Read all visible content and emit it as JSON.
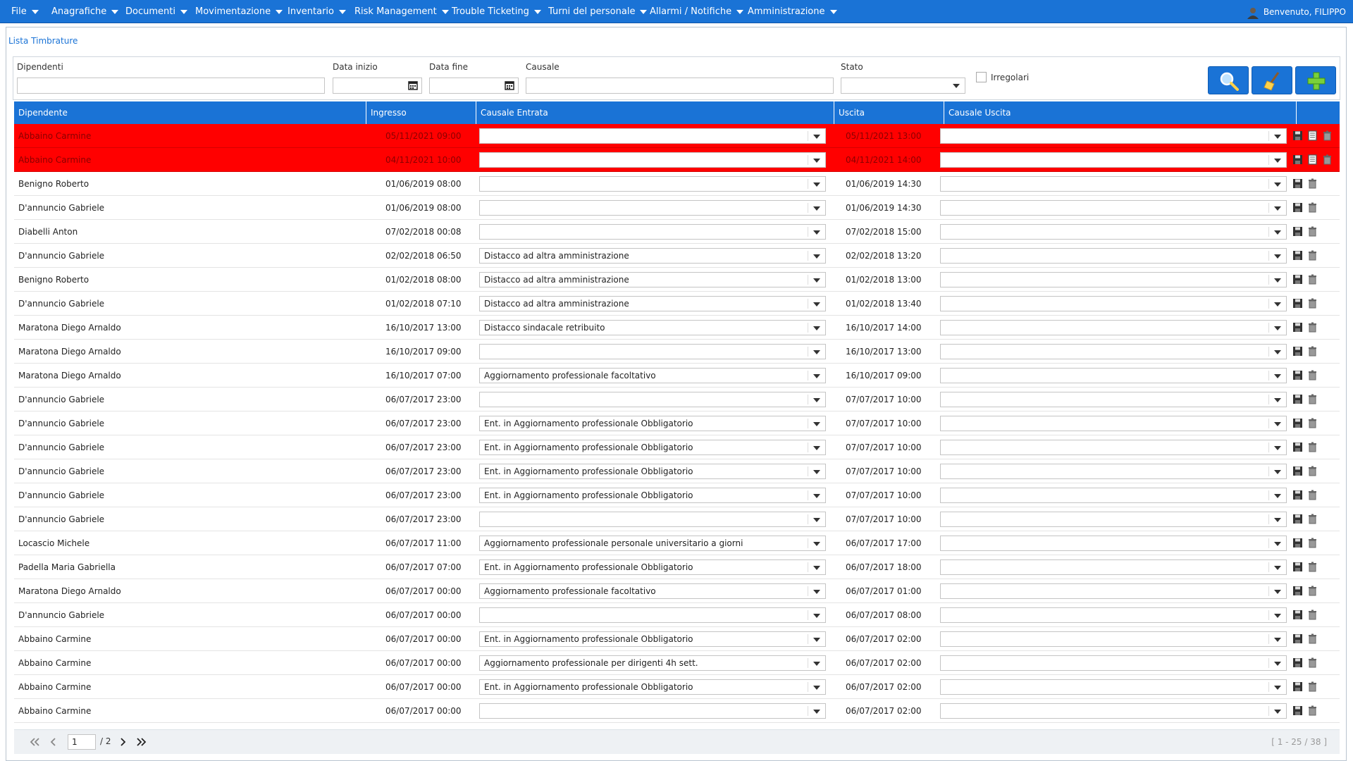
{
  "menu": {
    "items": [
      "File",
      "Anagrafiche",
      "Documenti",
      "Movimentazione",
      "Inventario",
      "Risk Management",
      "Trouble Ticketing",
      "Turni del personale",
      "Allarmi / Notifiche",
      "Amministrazione"
    ],
    "welcome": "Benvenuto, FILIPPO"
  },
  "page": {
    "title": "Lista Timbrature"
  },
  "filters": {
    "dipendenti_label": "Dipendenti",
    "data_inizio_label": "Data inizio",
    "data_fine_label": "Data fine",
    "causale_label": "Causale",
    "stato_label": "Stato",
    "irregolari_label": "Irregolari"
  },
  "grid": {
    "headers": [
      "Dipendente",
      "Ingresso",
      "Causale Entrata",
      "Uscita",
      "Causale Uscita"
    ],
    "rows": [
      {
        "dipendente": "Abbaino Carmine",
        "ingresso": "05/11/2021 09:00",
        "causale_entrata": "",
        "uscita": "05/11/2021 13:00",
        "causale_uscita": "",
        "irregolare": true
      },
      {
        "dipendente": "Abbaino Carmine",
        "ingresso": "04/11/2021 10:00",
        "causale_entrata": "",
        "uscita": "04/11/2021 14:00",
        "causale_uscita": "",
        "irregolare": true
      },
      {
        "dipendente": "Benigno Roberto",
        "ingresso": "01/06/2019 08:00",
        "causale_entrata": "",
        "uscita": "01/06/2019 14:30",
        "causale_uscita": "",
        "irregolare": false
      },
      {
        "dipendente": "D'annuncio Gabriele",
        "ingresso": "01/06/2019 08:00",
        "causale_entrata": "",
        "uscita": "01/06/2019 14:30",
        "causale_uscita": "",
        "irregolare": false
      },
      {
        "dipendente": "Diabelli Anton",
        "ingresso": "07/02/2018 00:08",
        "causale_entrata": "",
        "uscita": "07/02/2018 15:00",
        "causale_uscita": "",
        "irregolare": false
      },
      {
        "dipendente": "D'annuncio Gabriele",
        "ingresso": "02/02/2018 06:50",
        "causale_entrata": "Distacco ad altra amministrazione",
        "uscita": "02/02/2018 13:20",
        "causale_uscita": "",
        "irregolare": false
      },
      {
        "dipendente": "Benigno Roberto",
        "ingresso": "01/02/2018 08:00",
        "causale_entrata": "Distacco ad altra amministrazione",
        "uscita": "01/02/2018 13:00",
        "causale_uscita": "",
        "irregolare": false
      },
      {
        "dipendente": "D'annuncio Gabriele",
        "ingresso": "01/02/2018 07:10",
        "causale_entrata": "Distacco ad altra amministrazione",
        "uscita": "01/02/2018 13:40",
        "causale_uscita": "",
        "irregolare": false
      },
      {
        "dipendente": "Maratona Diego Arnaldo",
        "ingresso": "16/10/2017 13:00",
        "causale_entrata": "Distacco sindacale retribuito",
        "uscita": "16/10/2017 14:00",
        "causale_uscita": "",
        "irregolare": false
      },
      {
        "dipendente": "Maratona Diego Arnaldo",
        "ingresso": "16/10/2017 09:00",
        "causale_entrata": "",
        "uscita": "16/10/2017 13:00",
        "causale_uscita": "",
        "irregolare": false
      },
      {
        "dipendente": "Maratona Diego Arnaldo",
        "ingresso": "16/10/2017 07:00",
        "causale_entrata": "Aggiornamento professionale facoltativo",
        "uscita": "16/10/2017 09:00",
        "causale_uscita": "",
        "irregolare": false
      },
      {
        "dipendente": "D'annuncio Gabriele",
        "ingresso": "06/07/2017 23:00",
        "causale_entrata": "",
        "uscita": "07/07/2017 10:00",
        "causale_uscita": "",
        "irregolare": false
      },
      {
        "dipendente": "D'annuncio Gabriele",
        "ingresso": "06/07/2017 23:00",
        "causale_entrata": "Ent. in Aggiornamento professionale Obbligatorio",
        "uscita": "07/07/2017 10:00",
        "causale_uscita": "",
        "irregolare": false
      },
      {
        "dipendente": "D'annuncio Gabriele",
        "ingresso": "06/07/2017 23:00",
        "causale_entrata": "Ent. in Aggiornamento professionale Obbligatorio",
        "uscita": "07/07/2017 10:00",
        "causale_uscita": "",
        "irregolare": false
      },
      {
        "dipendente": "D'annuncio Gabriele",
        "ingresso": "06/07/2017 23:00",
        "causale_entrata": "Ent. in Aggiornamento professionale Obbligatorio",
        "uscita": "07/07/2017 10:00",
        "causale_uscita": "",
        "irregolare": false
      },
      {
        "dipendente": "D'annuncio Gabriele",
        "ingresso": "06/07/2017 23:00",
        "causale_entrata": "Ent. in Aggiornamento professionale Obbligatorio",
        "uscita": "07/07/2017 10:00",
        "causale_uscita": "",
        "irregolare": false
      },
      {
        "dipendente": "D'annuncio Gabriele",
        "ingresso": "06/07/2017 23:00",
        "causale_entrata": "",
        "uscita": "07/07/2017 10:00",
        "causale_uscita": "",
        "irregolare": false
      },
      {
        "dipendente": "Locascio Michele",
        "ingresso": "06/07/2017 11:00",
        "causale_entrata": "Aggiornamento professionale personale universitario a giorni",
        "uscita": "06/07/2017 17:00",
        "causale_uscita": "",
        "irregolare": false
      },
      {
        "dipendente": "Padella Maria Gabriella",
        "ingresso": "06/07/2017 07:00",
        "causale_entrata": "Ent. in Aggiornamento professionale Obbligatorio",
        "uscita": "06/07/2017 18:00",
        "causale_uscita": "",
        "irregolare": false
      },
      {
        "dipendente": "Maratona Diego Arnaldo",
        "ingresso": "06/07/2017 00:00",
        "causale_entrata": "Aggiornamento professionale facoltativo",
        "uscita": "06/07/2017 01:00",
        "causale_uscita": "",
        "irregolare": false
      },
      {
        "dipendente": "D'annuncio Gabriele",
        "ingresso": "06/07/2017 00:00",
        "causale_entrata": "",
        "uscita": "06/07/2017 08:00",
        "causale_uscita": "",
        "irregolare": false
      },
      {
        "dipendente": "Abbaino Carmine",
        "ingresso": "06/07/2017 00:00",
        "causale_entrata": "Ent. in Aggiornamento professionale Obbligatorio",
        "uscita": "06/07/2017 02:00",
        "causale_uscita": "",
        "irregolare": false
      },
      {
        "dipendente": "Abbaino Carmine",
        "ingresso": "06/07/2017 00:00",
        "causale_entrata": "Aggiornamento professionale per dirigenti 4h sett.",
        "uscita": "06/07/2017 02:00",
        "causale_uscita": "",
        "irregolare": false
      },
      {
        "dipendente": "Abbaino Carmine",
        "ingresso": "06/07/2017 00:00",
        "causale_entrata": "Ent. in Aggiornamento professionale Obbligatorio",
        "uscita": "06/07/2017 02:00",
        "causale_uscita": "",
        "irregolare": false
      },
      {
        "dipendente": "Abbaino Carmine",
        "ingresso": "06/07/2017 00:00",
        "causale_entrata": "",
        "uscita": "06/07/2017 02:00",
        "causale_uscita": "",
        "irregolare": false
      }
    ]
  },
  "pager": {
    "page": "1",
    "total": "/ 2",
    "range": "[ 1 - 25 / 38 ]"
  },
  "colors": {
    "accent": "#1a73d6",
    "irregular": "#ff0000"
  },
  "icons": {
    "search": "search-icon",
    "clear": "broom-icon",
    "add": "add-icon",
    "save": "save-icon",
    "delete": "trash-icon",
    "calendar": "calendar-icon"
  }
}
